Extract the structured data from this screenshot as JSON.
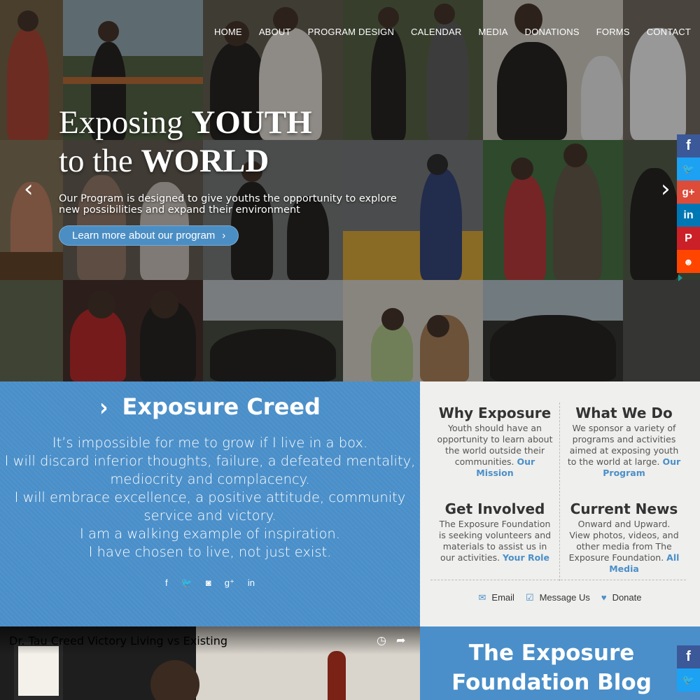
{
  "nav": {
    "items": [
      "HOME",
      "ABOUT",
      "PROGRAM DESIGN",
      "CALENDAR",
      "MEDIA",
      "DONATIONS",
      "FORMS",
      "CONTACT"
    ]
  },
  "hero": {
    "headline_word1": "Exposing",
    "headline_word2": "YOUTH",
    "headline_word3": "to the",
    "headline_word4": "WORLD",
    "subtitle": "Our Program is designed to give youths the opportunity to explore new possibilities and expand their environment",
    "cta_label": "Learn more about our program",
    "cta_chevron": "›",
    "arrow_left": "‹",
    "arrow_right": "›"
  },
  "social": {
    "fb": "f",
    "tw": "🐦",
    "gp": "g+",
    "li": "in",
    "pi": "P",
    "re": "☻"
  },
  "creed": {
    "chevron": "›",
    "title": "Exposure Creed",
    "lines": [
      "It’s impossible for me to grow if I live in a box.",
      "I will discard inferior thoughts, failure, a defeated mentality,",
      "mediocrity and complacency.",
      "I will embrace excellence, a positive attitude, community",
      "service and victory.",
      "I am a walking example of inspiration.",
      "I have chosen to live, not just exist."
    ],
    "social_icons": [
      "f",
      "🐦",
      "◙",
      "g⁺",
      "in"
    ]
  },
  "info": {
    "why": {
      "title": "Why Exposure",
      "text": "Youth should have an opportunity to learn about the world outside their communities.",
      "link": "Our Mission"
    },
    "what": {
      "title": "What We Do",
      "text": "We sponsor a variety of programs and activities aimed at exposing youth to the world at large.",
      "link": "Our Program"
    },
    "involved": {
      "title": "Get Involved",
      "text": "The Exposure Foundation is seeking volunteers and materials to assist us in our activities.",
      "link": "Your Role"
    },
    "news": {
      "title": "Current News",
      "text": "Onward and Upward. View photos, videos, and other media from The Exposure Foundation.",
      "link": "All Media"
    },
    "actions": {
      "email_icon": "✉",
      "email": "Email",
      "message_icon": "☑",
      "message": "Message Us",
      "donate_icon": "♥",
      "donate": "Donate"
    }
  },
  "video": {
    "title": "Dr. Tau Creed Victory Living vs Existing",
    "clock_icon": "◷",
    "share_icon": "➦"
  },
  "blog": {
    "title": "The Exposure Foundation Blog"
  },
  "colors": {
    "accent_blue": "#4a8fc9",
    "info_bg": "#efefed"
  }
}
